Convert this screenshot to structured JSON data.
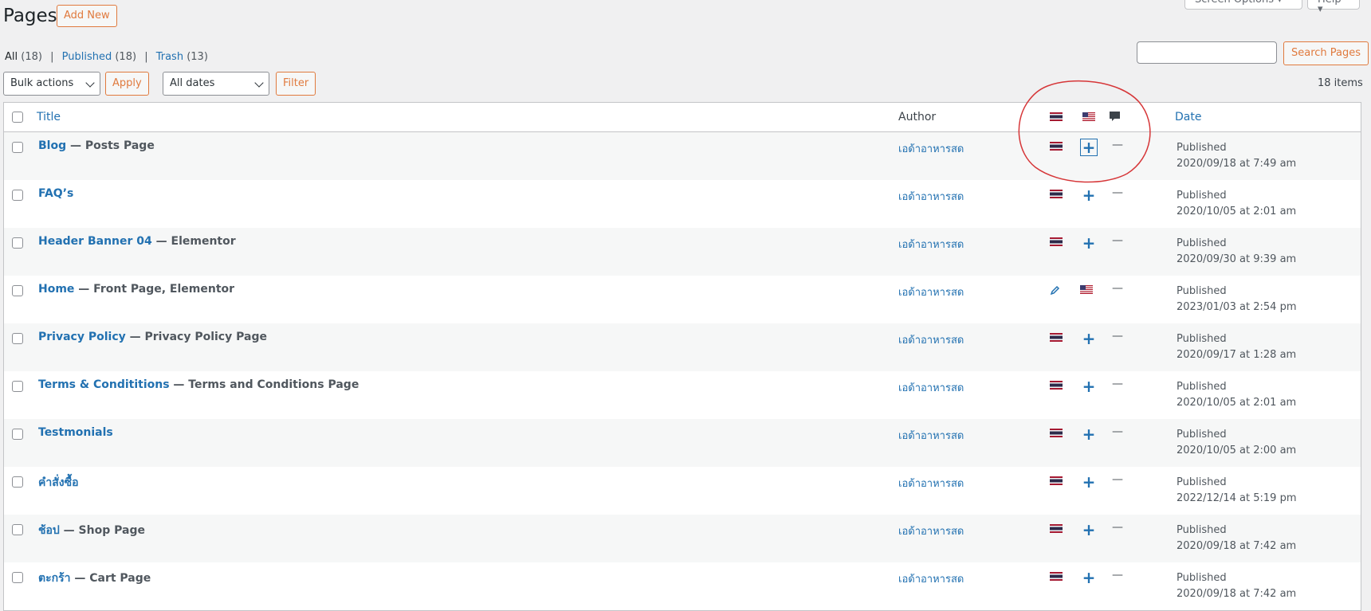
{
  "header": {
    "title": "Pages",
    "add_new": "Add New",
    "screen_options": "Screen Options ▾",
    "help": "Help ▾"
  },
  "views": [
    {
      "label": "All",
      "count": "(18)"
    },
    {
      "label": "Published",
      "count": "(18)"
    },
    {
      "label": "Trash",
      "count": "(13)"
    }
  ],
  "search": {
    "button": "Search Pages",
    "value": ""
  },
  "bulk_actions": {
    "selected": "Bulk actions",
    "apply": "Apply"
  },
  "date_filter": {
    "selected": "All dates",
    "filter": "Filter"
  },
  "items_count": "18 items",
  "columns": {
    "title": "Title",
    "author": "Author",
    "date": "Date"
  },
  "language_icons": {
    "col1": "thai-flag-icon",
    "col2": "us-flag-icon",
    "comments": "comment-bubble-icon"
  },
  "colors": {
    "accent_link": "#2271b1",
    "button_orange": "#e07a3e",
    "annotation_red": "#d63638"
  },
  "rows": [
    {
      "title": "Blog",
      "state": " — Posts Page",
      "author": "เอด้าอาหารสด",
      "status": "Published",
      "date": "2020/09/18 at 7:49 am",
      "lang2": "add",
      "comments": "—"
    },
    {
      "title": "FAQ’s",
      "state": "",
      "author": "เอด้าอาหารสด",
      "status": "Published",
      "date": "2020/10/05 at 2:01 am",
      "lang2": "add",
      "comments": "—"
    },
    {
      "title": "Header Banner 04",
      "state": " — Elementor",
      "author": "เอด้าอาหารสด",
      "status": "Published",
      "date": "2020/09/30 at 9:39 am",
      "lang2": "add",
      "comments": "—"
    },
    {
      "title": "Home",
      "state": " — Front Page, Elementor",
      "author": "เอด้าอาหารสด",
      "status": "Published",
      "date": "2023/01/03 at 2:54 pm",
      "lang2": "flag",
      "comments": "—"
    },
    {
      "title": "Privacy Policy",
      "state": " — Privacy Policy Page",
      "author": "เอด้าอาหารสด",
      "status": "Published",
      "date": "2020/09/17 at 1:28 am",
      "lang2": "add",
      "comments": "—"
    },
    {
      "title": "Terms & Condititions",
      "state": " — Terms and Conditions Page",
      "author": "เอด้าอาหารสด",
      "status": "Published",
      "date": "2020/10/05 at 2:01 am",
      "lang2": "add",
      "comments": "—"
    },
    {
      "title": "Testmonials",
      "state": "",
      "author": "เอด้าอาหารสด",
      "status": "Published",
      "date": "2020/10/05 at 2:00 am",
      "lang2": "add",
      "comments": "—"
    },
    {
      "title": "คำสั่งซื้อ",
      "state": "",
      "author": "เอด้าอาหารสด",
      "status": "Published",
      "date": "2022/12/14 at 5:19 pm",
      "lang2": "add",
      "comments": "—"
    },
    {
      "title": "ช้อป",
      "state": " — Shop Page",
      "author": "เอด้าอาหารสด",
      "status": "Published",
      "date": "2020/09/18 at 7:42 am",
      "lang2": "add",
      "comments": "—"
    },
    {
      "title": "ตะกร้า",
      "state": " — Cart Page",
      "author": "เอด้าอาหารสด",
      "status": "Published",
      "date": "2020/09/18 at 7:42 am",
      "lang2": "add",
      "comments": "—"
    }
  ]
}
